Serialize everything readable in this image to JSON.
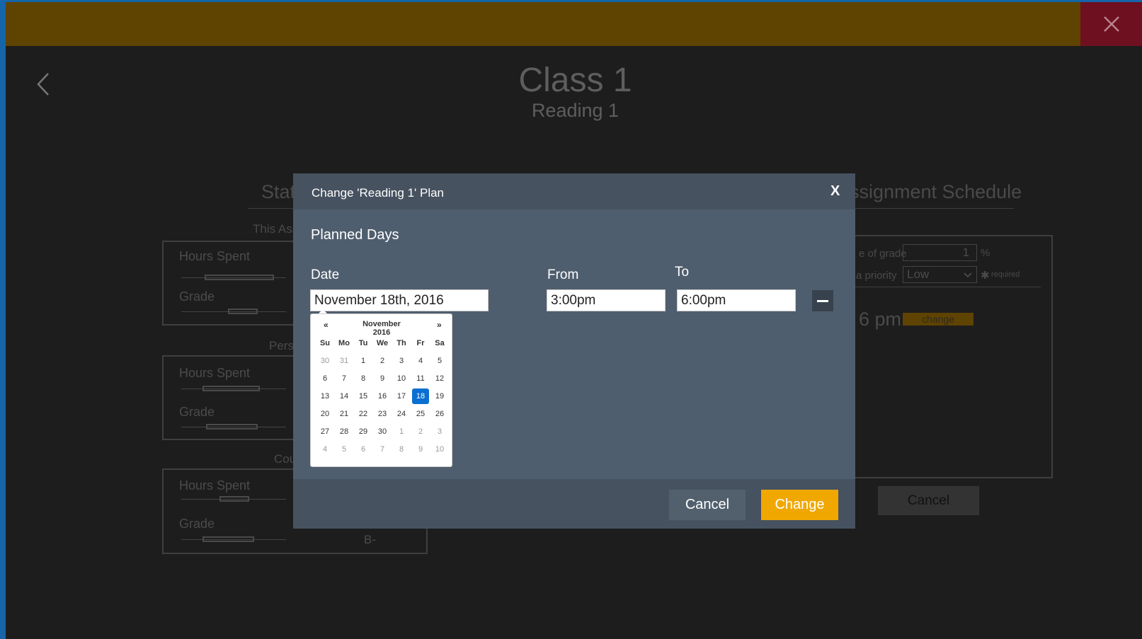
{
  "header": {
    "title": "Class 1",
    "subtitle": "Reading 1"
  },
  "background": {
    "stats_heading": "Stat",
    "this_section": "This Ass",
    "pers_section": "Pers",
    "cou_section": "Cou",
    "hours_label": "Hours Spent",
    "grade_label": "Grade",
    "grade_value": "B-",
    "assignment_heading": "ssignment Schedule",
    "pct_label": "e of grade",
    "pct_value": "1",
    "pct_unit": "%",
    "priority_label": "a priority",
    "priority_value": "Low",
    "required_label": "required",
    "time_text": "6 pm",
    "change_label": "change",
    "cancel_label": "Cancel"
  },
  "modal": {
    "title": "Change 'Reading 1' Plan",
    "close": "X",
    "section": "Planned Days",
    "date_label": "Date",
    "from_label": "From",
    "to_label": "To",
    "date_value": "November 18th, 2016",
    "from_value": "3:00pm",
    "to_value": "6:00pm",
    "cancel_label": "Cancel",
    "change_label": "Change"
  },
  "datepicker": {
    "prev": "«",
    "next": "»",
    "month": "November 2016",
    "weekdays": [
      "Su",
      "Mo",
      "Tu",
      "We",
      "Th",
      "Fr",
      "Sa"
    ],
    "weeks": [
      [
        "30",
        "31",
        "1",
        "2",
        "3",
        "4",
        "5"
      ],
      [
        "6",
        "7",
        "8",
        "9",
        "10",
        "11",
        "12"
      ],
      [
        "13",
        "14",
        "15",
        "16",
        "17",
        "18",
        "19"
      ],
      [
        "20",
        "21",
        "22",
        "23",
        "24",
        "25",
        "26"
      ],
      [
        "27",
        "28",
        "29",
        "30",
        "1",
        "2",
        "3"
      ],
      [
        "4",
        "5",
        "6",
        "7",
        "8",
        "9",
        "10"
      ]
    ],
    "selected": "18"
  },
  "colors": {
    "accent": "#f0a800",
    "selected_day": "#0b6fd1",
    "top_bar": "#5f4300",
    "close_top": "#6e1020"
  }
}
